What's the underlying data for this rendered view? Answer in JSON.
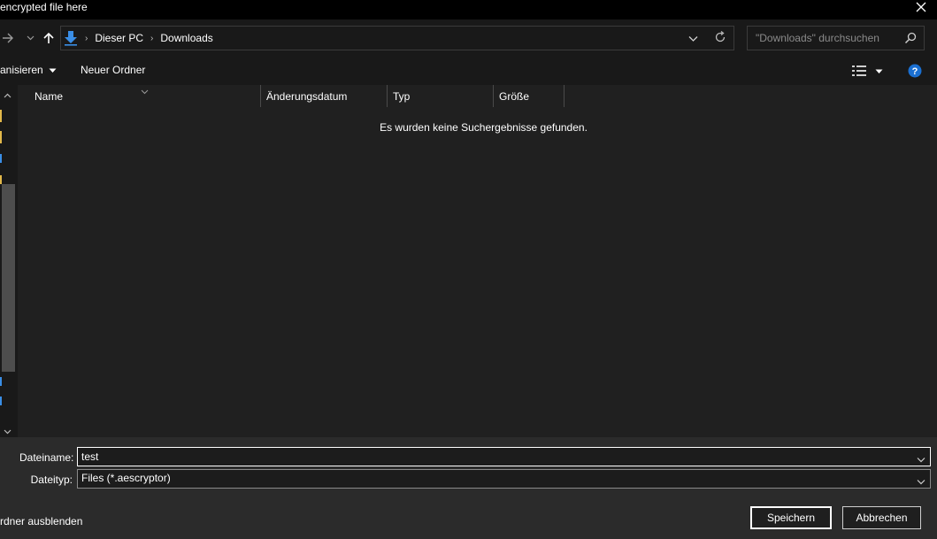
{
  "window": {
    "title": "encrypted file here"
  },
  "navigation": {
    "breadcrumbs": [
      "Dieser PC",
      "Downloads"
    ],
    "search_placeholder": "\"Downloads\" durchsuchen"
  },
  "commands": {
    "organize": "anisieren",
    "new_folder": "Neuer Ordner"
  },
  "file_list": {
    "columns": [
      "Name",
      "Änderungsdatum",
      "Typ",
      "Größe"
    ],
    "empty_message": "Es wurden keine Suchergebnisse gefunden."
  },
  "save_form": {
    "filename_label": "Dateiname:",
    "filename_value": "test",
    "filetype_label": "Dateityp:",
    "filetype_value": "Files (*.aescryptor)",
    "hide_folders": "rdner ausblenden",
    "save_button": "Speichern",
    "cancel_button": "Abbrechen"
  },
  "colors": {
    "accent": "#0078d4",
    "background": "#202020",
    "toolbar": "#191919",
    "footer": "#2b2b2b"
  },
  "icons": [
    "close-icon",
    "back-arrow-icon",
    "forward-arrow-icon",
    "recent-dropdown-icon",
    "up-arrow-icon",
    "downloads-icon",
    "refresh-icon",
    "search-icon",
    "view-options-icon",
    "help-icon"
  ]
}
